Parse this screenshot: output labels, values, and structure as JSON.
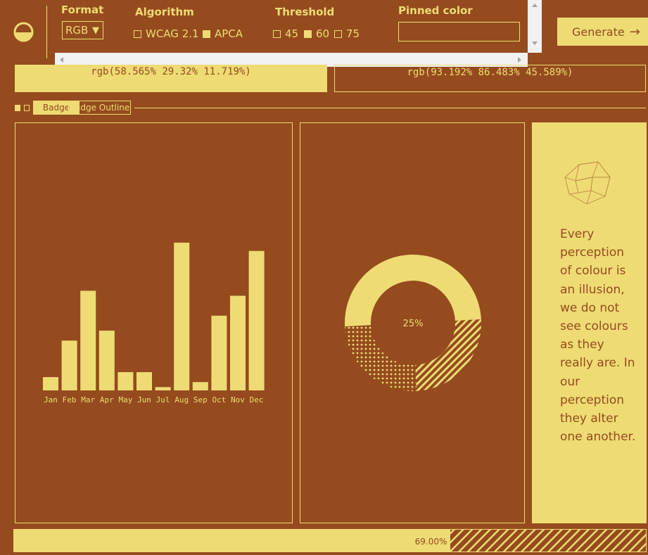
{
  "colors": {
    "background": "#954b1e",
    "foreground": "#eedb74"
  },
  "toolbar": {
    "format": {
      "label": "Format",
      "selected": "RGB"
    },
    "algorithm": {
      "label": "Algorithm",
      "options": [
        {
          "label": "WCAG 2.1",
          "checked": false
        },
        {
          "label": "APCA",
          "checked": true
        }
      ]
    },
    "threshold": {
      "label": "Threshold",
      "options": [
        {
          "label": "45",
          "checked": false
        },
        {
          "label": "60",
          "checked": true
        },
        {
          "label": "75",
          "checked": false
        }
      ]
    },
    "pinned": {
      "label": "Pinned color",
      "value": ""
    },
    "generate_label": "Generate"
  },
  "colors_readout": {
    "first": "rgb(58.565% 29.32% 11.719%)",
    "second": "rgb(93.192% 86.483% 45.589%)"
  },
  "badges": {
    "solid": "Badge",
    "outline": "Badge Outline"
  },
  "chart_data": [
    {
      "type": "bar",
      "categories": [
        "Jan",
        "Feb",
        "Mar",
        "Apr",
        "May",
        "Jun",
        "Jul",
        "Aug",
        "Sep",
        "Oct",
        "Nov",
        "Dec"
      ],
      "values": [
        8,
        30,
        60,
        36,
        11,
        11,
        2,
        89,
        5,
        45,
        57,
        84
      ],
      "ylim": [
        0,
        100
      ]
    },
    {
      "type": "pie",
      "labels": [
        "25%"
      ],
      "values": [
        50,
        25,
        25
      ]
    }
  ],
  "quote": "Every perception of colour is an illusion, we do not see colours as they really are. In our perception they alter one another.",
  "progress": {
    "value": 0.69,
    "label": "69.00%"
  }
}
